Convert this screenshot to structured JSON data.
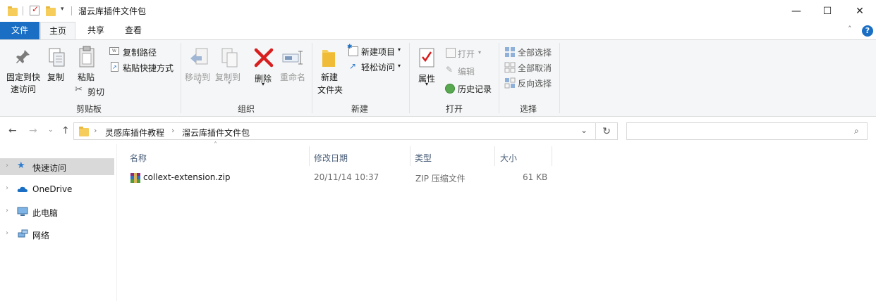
{
  "window": {
    "title": "溜云库插件文件包",
    "controls": {
      "minimize": "—",
      "maximize": "☐",
      "close": "✕"
    }
  },
  "tabs": {
    "file": "文件",
    "home": "主页",
    "share": "共享",
    "view": "查看"
  },
  "ribbon": {
    "clipboard": {
      "label": "剪贴板",
      "pin": "固定到快速访问",
      "pin_line1": "固定到快",
      "pin_line2": "速访问",
      "copy": "复制",
      "paste": "粘贴",
      "copy_path": "复制路径",
      "paste_shortcut": "粘贴快捷方式",
      "cut": "剪切"
    },
    "organize": {
      "label": "组织",
      "move_to": "移动到",
      "copy_to": "复制到",
      "delete": "删除",
      "rename": "重命名"
    },
    "new": {
      "label": "新建",
      "new_folder_line1": "新建",
      "new_folder_line2": "文件夹",
      "new_item": "新建项目",
      "easy_access": "轻松访问"
    },
    "open": {
      "label": "打开",
      "properties": "属性",
      "open": "打开",
      "edit": "编辑",
      "history": "历史记录"
    },
    "select": {
      "label": "选择",
      "select_all": "全部选择",
      "select_none": "全部取消",
      "invert": "反向选择"
    }
  },
  "address": {
    "breadcrumb": [
      "灵感库插件教程",
      "溜云库插件文件包"
    ]
  },
  "navpane": {
    "items": [
      {
        "label": "快速访问",
        "selected": true
      },
      {
        "label": "OneDrive",
        "selected": false
      },
      {
        "label": "此电脑",
        "selected": false
      },
      {
        "label": "网络",
        "selected": false
      }
    ]
  },
  "filelist": {
    "columns": [
      "名称",
      "修改日期",
      "类型",
      "大小"
    ],
    "rows": [
      {
        "name": "collext-extension.zip",
        "modified": "20/11/14 10:37",
        "type": "ZIP 压缩文件",
        "size": "61 KB"
      }
    ]
  },
  "colors": {
    "accent": "#1a6fc4",
    "ribbon_bg": "#f5f6f7",
    "delete_red": "#d81e1e"
  }
}
